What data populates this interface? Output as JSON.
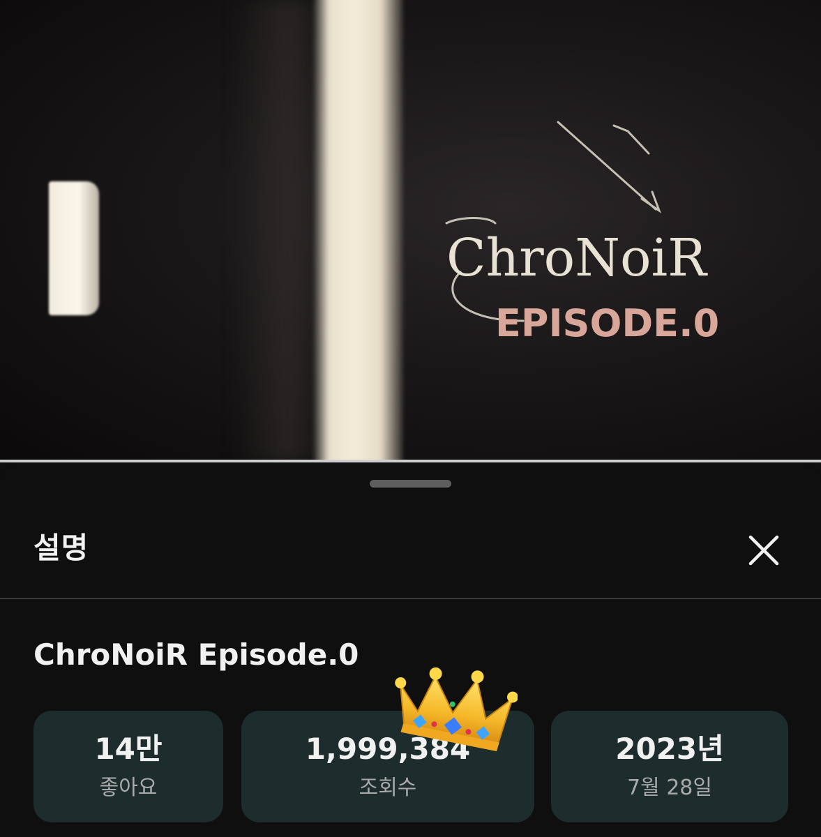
{
  "video": {
    "overlay_text_line1": "ChroNoiR",
    "overlay_text_line2": "EPISODE.0"
  },
  "sheet": {
    "title": "설명",
    "close_icon": "close-icon"
  },
  "description": {
    "video_title": "ChroNoiR Episode.0",
    "stats": [
      {
        "value": "14만",
        "label": "좋아요"
      },
      {
        "value": "1,999,384",
        "label": "조회수"
      },
      {
        "value": "2023년",
        "label": "7월 28일"
      }
    ]
  },
  "decoration": {
    "crown_emoji": "crown-icon"
  },
  "colors": {
    "background": "#0f0f0f",
    "stat_card": "#1d2c2d",
    "text_primary": "#f1f1f1",
    "text_secondary": "#aaaaaa"
  }
}
